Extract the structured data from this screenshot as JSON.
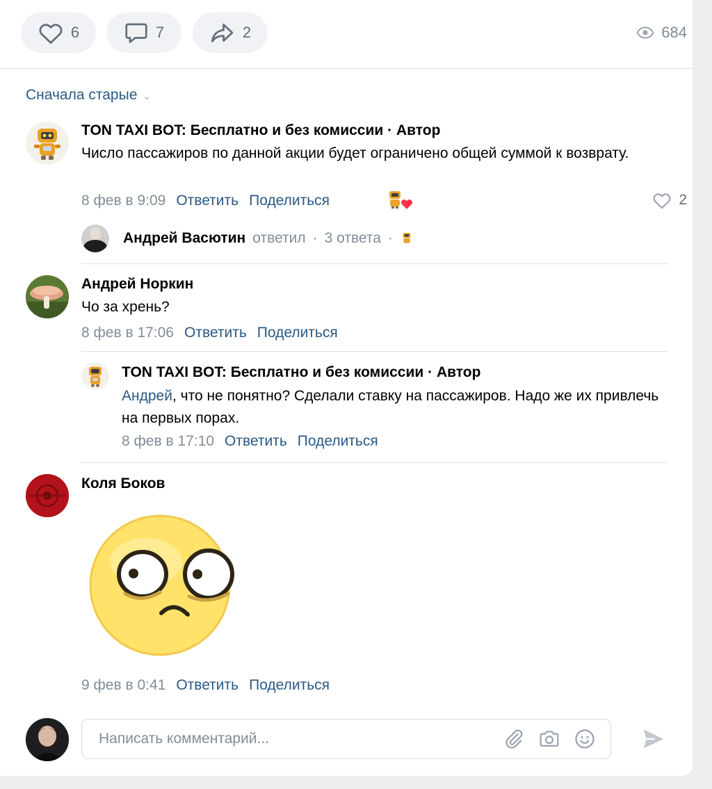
{
  "actions": {
    "likes": "6",
    "comments": "7",
    "shares": "2",
    "views": "684"
  },
  "sort_label": "Сначала старые",
  "comments": [
    {
      "author": "TON TAXI BOT: Бесплатно и без комиссии · Автор",
      "text": "Число пассажиров по данной акции будет ограничено общей суммой к возврату.",
      "date": "8 фев в 9:09",
      "reply": "Ответить",
      "share": "Поделиться",
      "likes": "2"
    },
    {
      "author": "Андрей Норкин",
      "text": "Чо за хрень?",
      "date": "8 фев в 17:06",
      "reply": "Ответить",
      "share": "Поделиться"
    },
    {
      "author": "TON TAXI BOT: Бесплатно и без комиссии · Автор",
      "mention": "Андрей",
      "text": ", что не понятно? Сделали ставку на пассажиров. Надо же их привлечь на первых порах.",
      "date": "8 фев в 17:10",
      "reply": "Ответить",
      "share": "Поделиться"
    },
    {
      "author": "Коля Боков",
      "date": "9 фев в 0:41",
      "reply": "Ответить",
      "share": "Поделиться"
    }
  ],
  "replies_summary": {
    "name": "Андрей Васютин",
    "action": "ответил",
    "dot": "·",
    "count": "3 ответа"
  },
  "composer": {
    "placeholder": "Написать комментарий..."
  },
  "colors": {
    "link": "#2a5885",
    "meta": "#818c99",
    "heart": "#ff3347",
    "sticker_face": "#ffe26a"
  },
  "icons": [
    "heart-icon",
    "comment-icon",
    "share-icon",
    "eye-icon",
    "chevron-down-icon",
    "paperclip-icon",
    "camera-icon",
    "smile-icon",
    "send-icon"
  ]
}
